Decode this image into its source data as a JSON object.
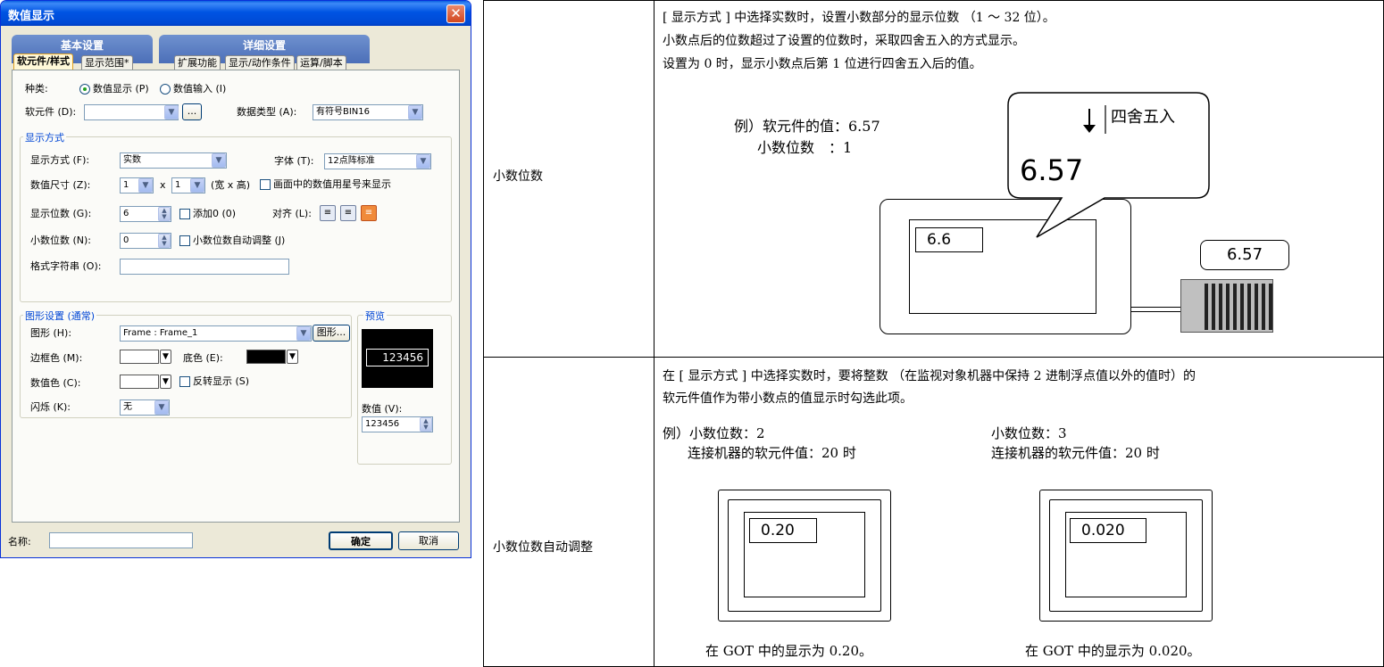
{
  "dialog": {
    "title": "数值显示",
    "close_glyph": "✕",
    "group_basic": "基本设置",
    "group_detail": "详细设置",
    "tabs": [
      "软元件/样式",
      "显示范围*",
      "扩展功能",
      "显示/动作条件",
      "运算/脚本"
    ],
    "kind_label": "种类:",
    "kind_option1": "数值显示 (P)",
    "kind_option2": "数值输入 (I)",
    "device_label": "软元件 (D):",
    "device_value": "",
    "device_btn": "...",
    "datatype_label": "数据类型 (A):",
    "datatype_value": "有符号BIN16",
    "display_group": "显示方式",
    "display_mode_label": "显示方式 (F):",
    "display_mode_value": "实数",
    "font_label": "字体 (T):",
    "font_value": "12点阵标准",
    "size_label": "数值尺寸 (Z):",
    "size_w": "1",
    "size_x": "x",
    "size_h": "1",
    "size_unit": "(宽 x 高)",
    "asterisk_label": "画面中的数值用星号来显示",
    "digits_label": "显示位数 (G):",
    "digits_value": "6",
    "add0_label": "添加0 (0)",
    "align_label": "对齐 (L):",
    "decimal_label": "小数位数 (N):",
    "decimal_value": "0",
    "auto_adjust_label": "小数位数自动调整 (J)",
    "format_label": "格式字符串 (O):",
    "format_value": "",
    "shape_group": "图形设置 (通常)",
    "shape_label": "图形 (H):",
    "shape_value": "Frame : Frame_1",
    "shape_btn": "图形...",
    "border_color_label": "边框色 (M):",
    "base_color_label": "底色 (E):",
    "num_color_label": "数值色 (C):",
    "reverse_label": "反转显示 (S)",
    "blink_label": "闪烁 (K):",
    "blink_value": "无",
    "preview_group": "预览",
    "preview_value": "123456",
    "value_label": "数值 (V):",
    "value_value": "123456",
    "name_label": "名称:",
    "name_value": "",
    "ok_btn": "确定",
    "cancel_btn": "取消"
  },
  "table": {
    "row1_label": "小数位数",
    "row1_desc": [
      "[ 显示方式 ] 中选择实数时，设置小数部分的显示位数 （1 ～ 32 位）。",
      "小数点后的位数超过了设置的位数时，采取四舍五入的方式显示。",
      "设置为 0 时，显示小数点后第 1 位进行四舍五入后的值。"
    ],
    "ex1_line1": "例）软元件的值：6.57",
    "ex1_line2": "小数位数　：1",
    "callout_round": "四舍五入",
    "callout_value": "6.57",
    "got_value": "6.6",
    "plc_value": "6.57",
    "row2_label": "小数位数自动调整",
    "row2_desc": [
      "在 [ 显示方式 ] 中选择实数时，要将整数 （在监视对象机器中保持 2 进制浮点值以外的值时）的",
      "软元件值作为带小数点的值显示时勾选此项。"
    ],
    "exA_line1": "例）小数位数：2",
    "exA_line2": "连接机器的软元件值：20 时",
    "exB_line1": "小数位数：3",
    "exB_line2": "连接机器的软元件值：20 时",
    "exA_value": "0.20",
    "exB_value": "0.020",
    "exA_caption": "在 GOT 中的显示为 0.20。",
    "exB_caption": "在 GOT 中的显示为 0.020。"
  }
}
